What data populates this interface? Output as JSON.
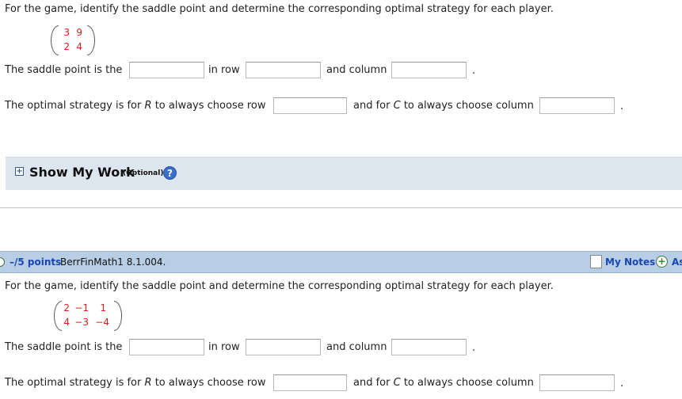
{
  "question1": {
    "prompt": "For the game, identify the saddle point and determine the corresponding optimal strategy for each player.",
    "matrix": [
      [
        "3",
        "9"
      ],
      [
        "2",
        "4"
      ]
    ],
    "saddle_label": "The saddle point is the",
    "in_row": "in row",
    "and_column": "and column",
    "period": ".",
    "optimal_prefix": "The optimal strategy is for",
    "player_r": "R",
    "to_always_row": "to always choose row",
    "and_for": "and for",
    "player_c": "C",
    "to_always_column": "to always choose column"
  },
  "show_work": {
    "plus": "+",
    "title": "Show My Work",
    "optional": "(Optional)",
    "help": "?"
  },
  "question2": {
    "points": "–/5 points",
    "code": "BerrFinMath1 8.1.004.",
    "my_notes": "My Notes",
    "ask": "As",
    "ask_plus": "+",
    "prompt": "For the game, identify the saddle point and determine the corresponding optimal strategy for each player.",
    "matrix": [
      [
        "2",
        "−1",
        "1"
      ],
      [
        "4",
        "−3",
        "−4"
      ]
    ],
    "saddle_label": "The saddle point is the",
    "in_row": "in row",
    "and_column": "and column",
    "period": ".",
    "optimal_prefix": "The optimal strategy is for",
    "player_r": "R",
    "to_always_row": "to always choose row",
    "and_for": "and for",
    "player_c": "C",
    "to_always_column": "to always choose column"
  },
  "colors": {
    "matrix_entry": "#d92020",
    "link": "#1a46b0",
    "question_bar": "#b7cee4",
    "work_panel": "#dde6ef"
  }
}
